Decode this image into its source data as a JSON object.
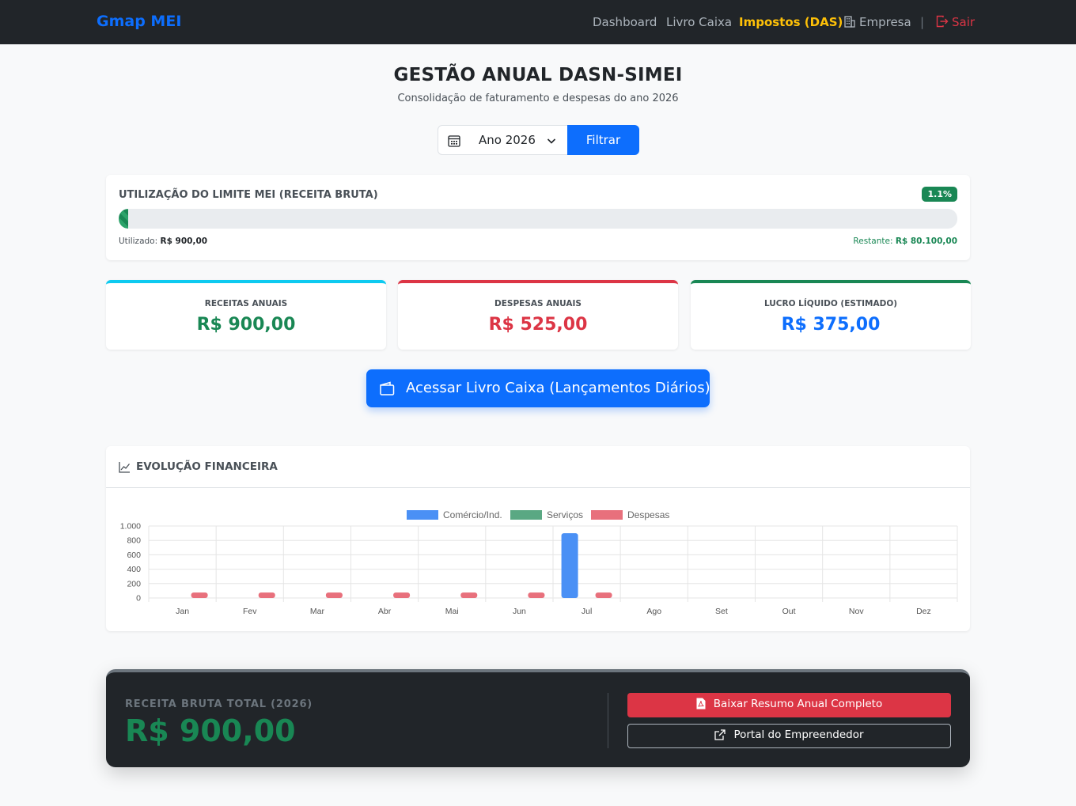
{
  "navbar": {
    "brand": "Gmap MEI",
    "links": {
      "dashboard": "Dashboard",
      "livro_caixa": "Livro Caixa",
      "impostos": "Impostos (DAS)",
      "empresa": "Empresa"
    },
    "separator": "|",
    "logout": "Sair"
  },
  "header": {
    "title": "GESTÃO ANUAL DASN-SIMEI",
    "subtitle": "Consolidação de faturamento e despesas do ano 2026"
  },
  "filter": {
    "year_selected": "Ano 2026",
    "button": "Filtrar"
  },
  "limit": {
    "title": "UTILIZAÇÃO DO LIMITE MEI (RECEITA BRUTA)",
    "percent_label": "1.1%",
    "percent_value": 0.011,
    "used_label": "Utilizado:",
    "used_value": "R$ 900,00",
    "remaining_label": "Restante:",
    "remaining_value": "R$ 80.100,00"
  },
  "stats": {
    "receitas": {
      "label": "RECEITAS ANUAIS",
      "value": "R$ 900,00",
      "color": "#198754"
    },
    "despesas": {
      "label": "DESPESAS ANUAIS",
      "value": "R$ 525,00",
      "color": "#dc3545"
    },
    "lucro": {
      "label": "LUCRO LÍQUIDO (ESTIMADO)",
      "value": "R$ 375,00",
      "color": "#0d6efd"
    }
  },
  "cash_book_button": "Acessar Livro Caixa (Lançamentos Diários)",
  "chart": {
    "title": "EVOLUÇÃO FINANCEIRA"
  },
  "chart_data": {
    "type": "bar",
    "categories": [
      "Jan",
      "Fev",
      "Mar",
      "Abr",
      "Mai",
      "Jun",
      "Jul",
      "Ago",
      "Set",
      "Out",
      "Nov",
      "Dez"
    ],
    "series": [
      {
        "name": "Comércio/Ind.",
        "color": "#4a90f5",
        "values": [
          0,
          0,
          0,
          0,
          0,
          0,
          900,
          0,
          0,
          0,
          0,
          0
        ]
      },
      {
        "name": "Serviços",
        "color": "#5aa883",
        "values": [
          0,
          0,
          0,
          0,
          0,
          0,
          0,
          0,
          0,
          0,
          0,
          0
        ]
      },
      {
        "name": "Despesas",
        "color": "#e8707c",
        "values": [
          75,
          75,
          75,
          75,
          75,
          75,
          75,
          0,
          0,
          0,
          0,
          0
        ]
      }
    ],
    "yticks": [
      "0",
      "200",
      "400",
      "600",
      "800",
      "1.000"
    ],
    "ylim": [
      0,
      1000
    ],
    "legend": "top-center",
    "grid": true
  },
  "summary": {
    "label": "RECEITA BRUTA TOTAL (2026)",
    "value": "R$ 900,00",
    "pdf_button": "Baixar Resumo Anual Completo",
    "portal_button": "Portal do Empreendedor"
  }
}
